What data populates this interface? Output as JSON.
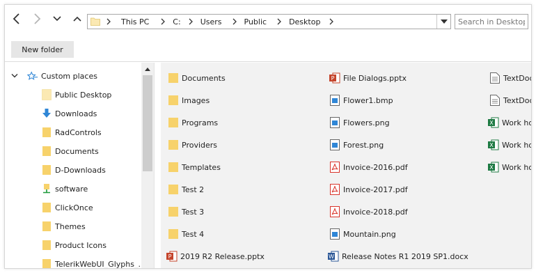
{
  "colors": {
    "folder": "#f7d26b",
    "folder_light": "#fbe9b3",
    "accent_blue": "#2f86d6",
    "pptx_red": "#c4442b",
    "pdf_red": "#d9342b",
    "word_blue": "#2b5797",
    "excel_green": "#1d7a43"
  },
  "nav": {
    "back_icon": "arrow-left-icon",
    "forward_icon": "arrow-right-icon",
    "recent_icon": "chevron-down-icon",
    "up_icon": "chevron-up-icon"
  },
  "address": {
    "crumbs": [
      "This PC",
      "C:",
      "Users",
      "Public",
      "Desktop"
    ]
  },
  "search": {
    "placeholder": "Search in Desktop"
  },
  "toolbar": {
    "new_folder_label": "New folder"
  },
  "tree": {
    "root_label": "Custom places",
    "items": [
      {
        "label": "Public Desktop",
        "icon": "folder-light-icon"
      },
      {
        "label": "Downloads",
        "icon": "download-arrow-icon"
      },
      {
        "label": "RadControls",
        "icon": "folder-icon"
      },
      {
        "label": "Documents",
        "icon": "folder-icon"
      },
      {
        "label": "D-Downloads",
        "icon": "folder-icon"
      },
      {
        "label": "software",
        "icon": "network-drive-icon"
      },
      {
        "label": "ClickOnce",
        "icon": "folder-icon"
      },
      {
        "label": "Themes",
        "icon": "folder-icon"
      },
      {
        "label": "Product Icons",
        "icon": "folder-icon"
      },
      {
        "label": "TelerikWebUI_Glyphs_...",
        "icon": "folder-icon"
      }
    ]
  },
  "files": {
    "col1": [
      {
        "label": "Documents",
        "icon": "folder-icon"
      },
      {
        "label": "Images",
        "icon": "folder-icon"
      },
      {
        "label": "Programs",
        "icon": "folder-icon"
      },
      {
        "label": "Providers",
        "icon": "folder-icon"
      },
      {
        "label": "Templates",
        "icon": "folder-icon"
      },
      {
        "label": "Test 2",
        "icon": "folder-icon"
      },
      {
        "label": "Test 3",
        "icon": "folder-icon"
      },
      {
        "label": "Test 4",
        "icon": "folder-icon"
      },
      {
        "label": "2019 R2 Release.pptx",
        "icon": "powerpoint-icon"
      }
    ],
    "col2": [
      {
        "label": "File Dialogs.pptx",
        "icon": "powerpoint-icon"
      },
      {
        "label": "Flower1.bmp",
        "icon": "image-icon"
      },
      {
        "label": "Flowers.png",
        "icon": "image-icon"
      },
      {
        "label": "Forest.png",
        "icon": "image-icon"
      },
      {
        "label": "Invoice-2016.pdf",
        "icon": "pdf-icon"
      },
      {
        "label": "Invoice-2017.pdf",
        "icon": "pdf-icon"
      },
      {
        "label": "Invoice-2018.pdf",
        "icon": "pdf-icon"
      },
      {
        "label": "Mountain.png",
        "icon": "image-icon"
      },
      {
        "label": "Release Notes R1 2019 SP1.docx",
        "icon": "word-icon"
      }
    ],
    "col3": [
      {
        "label": "TextDocu",
        "icon": "text-document-icon"
      },
      {
        "label": "TextDocu",
        "icon": "text-document-icon"
      },
      {
        "label": "Work ho",
        "icon": "excel-icon"
      },
      {
        "label": "Work ho",
        "icon": "excel-icon"
      },
      {
        "label": "Work ho",
        "icon": "excel-icon"
      }
    ]
  }
}
